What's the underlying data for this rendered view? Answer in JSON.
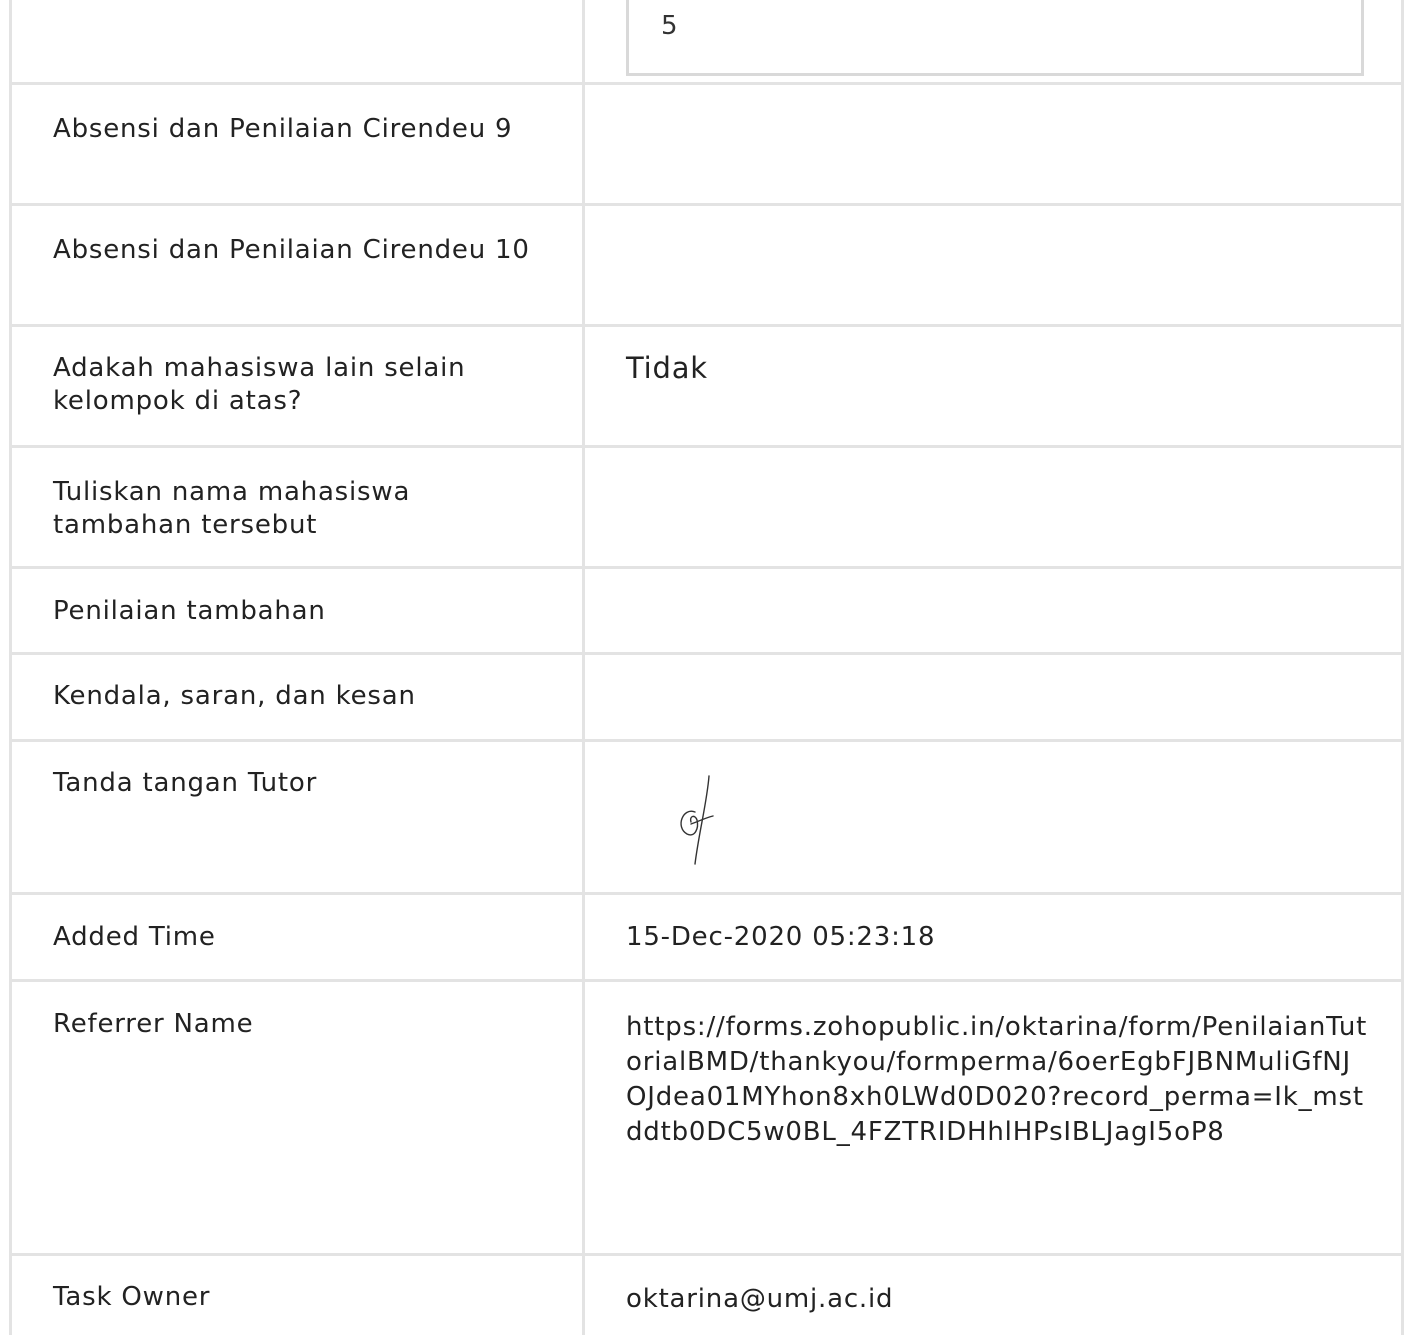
{
  "top_partial_row": {
    "value": "5"
  },
  "rows": [
    {
      "label": "Absensi dan Penilaian Cirendeu 9",
      "value": ""
    },
    {
      "label": "Absensi dan Penilaian Cirendeu 10",
      "value": ""
    },
    {
      "label": "Adakah mahasiswa lain selain kelompok di atas?",
      "value": "Tidak"
    },
    {
      "label": "Tuliskan nama mahasiswa tambahan tersebut",
      "value": ""
    },
    {
      "label": "Penilaian tambahan",
      "value": ""
    },
    {
      "label": "Kendala, saran, dan kesan",
      "value": ""
    },
    {
      "label": "Tanda tangan Tutor",
      "value": ""
    },
    {
      "label": "Added Time",
      "value": "15-Dec-2020 05:23:18"
    },
    {
      "label": "Referrer Name",
      "value": "https://forms.zohopublic.in/oktarina/form/PenilaianTutorialBMD/thankyou/formperma/6oerEgbFJBNMuliGfNJOJdea01MYhon8xh0LWd0D020?record_perma=Ik_mstddtb0DC5w0BL_4FZTRIDHhlHPsIBLJagI5oP8"
    },
    {
      "label": "Task Owner",
      "value": "oktarina@umj.ac.id"
    }
  ],
  "icons": {
    "signature": "signature-image"
  }
}
